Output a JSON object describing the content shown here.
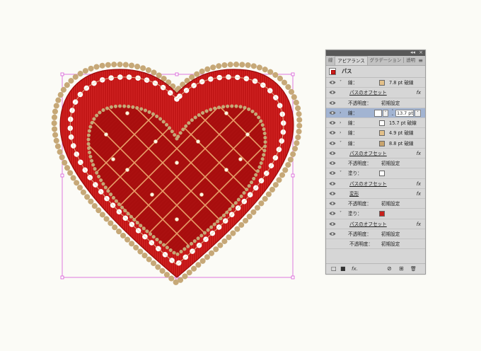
{
  "panel": {
    "tabs": [
      "線",
      "アピアランス",
      "グラデーション",
      "透明"
    ],
    "active_tab": 1,
    "object_name": "パス",
    "collapse_icon": "◂◂",
    "close_icon": "×",
    "menu_icon": "≡",
    "rows": [
      {
        "type": "attr",
        "label": "線：",
        "swatch": "#e3c089",
        "value": "7.8 pt 破線",
        "expanded": true
      },
      {
        "type": "fx",
        "label": "パスのオフセット"
      },
      {
        "type": "prop",
        "label": "不透明度：",
        "value": "初期設定"
      },
      {
        "type": "attr-selected",
        "label": "線：",
        "value": "13.7 pt"
      },
      {
        "type": "attr",
        "label": "線：",
        "swatch": "#ffffff",
        "value": "15.7 pt 破線",
        "expanded": false
      },
      {
        "type": "attr",
        "label": "線：",
        "swatch": "#e3c089",
        "value": "4.9 pt 破線",
        "expanded": false
      },
      {
        "type": "attr",
        "label": "線：",
        "swatch": "#c9a46e",
        "value": "8.8 pt 破線",
        "expanded": true
      },
      {
        "type": "fx",
        "label": "パスのオフセット"
      },
      {
        "type": "prop",
        "label": "不透明度：",
        "value": "初期設定"
      },
      {
        "type": "attr",
        "label": "塗り：",
        "swatch": "#ffffff",
        "value": "",
        "expanded": true
      },
      {
        "type": "fx",
        "label": "パスのオフセット"
      },
      {
        "type": "fx",
        "label": "変形"
      },
      {
        "type": "prop",
        "label": "不透明度：",
        "value": "初期設定"
      },
      {
        "type": "attr",
        "label": "塗り：",
        "swatch": "#c8201c",
        "value": "",
        "expanded": true
      },
      {
        "type": "fx",
        "label": "パスのオフセット"
      },
      {
        "type": "prop",
        "label": "不透明度：",
        "value": "初期設定"
      },
      {
        "type": "prop-root",
        "label": "不透明度：",
        "value": "初期設定"
      }
    ],
    "footer_icons": [
      "new-stroke-icon",
      "new-fill-icon",
      "fx-icon",
      "clear-icon",
      "duplicate-icon",
      "trash-icon"
    ],
    "footer_glyphs": [
      "□",
      "■",
      "fx.",
      "⊘",
      "⊞",
      "🗑"
    ]
  },
  "artwork": {
    "fill_color": "#b01010",
    "pleat_color": "#d42020",
    "pearl_color": "#ffffff",
    "bead_color": "#c6a877",
    "lattice_color": "#e8a06a",
    "selection_color": "#d85ad8"
  }
}
